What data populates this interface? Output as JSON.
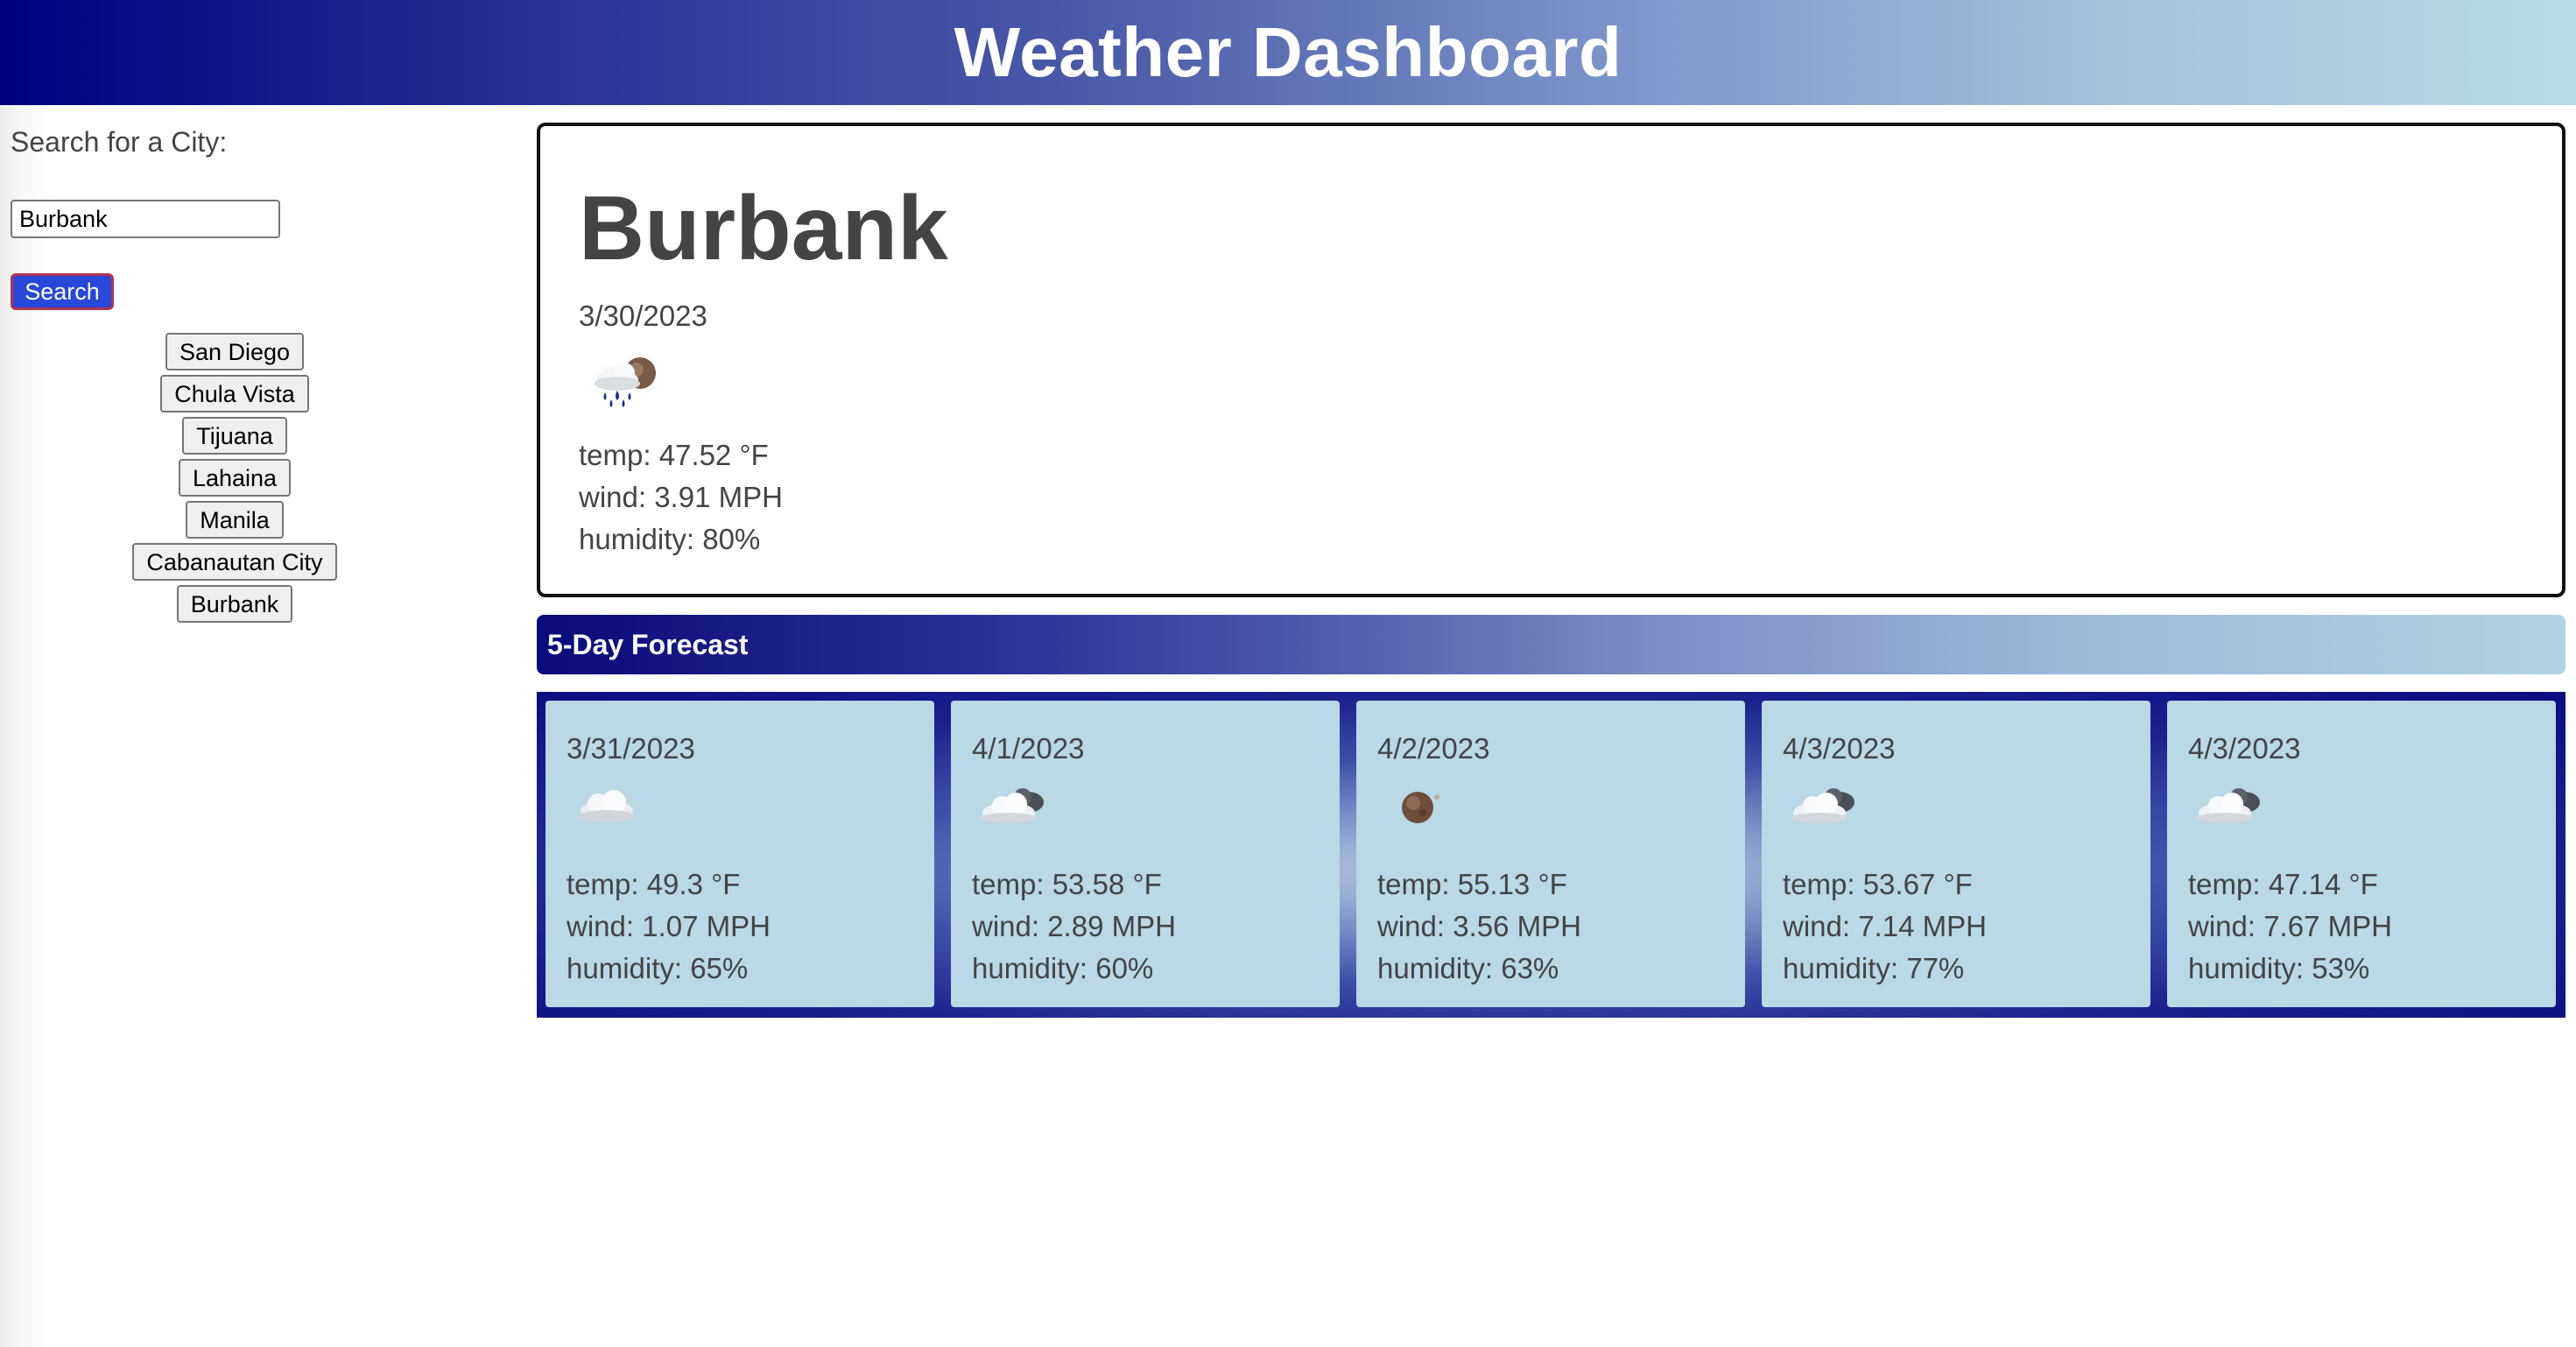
{
  "header": {
    "title": "Weather Dashboard"
  },
  "sidebar": {
    "search_label": "Search for a City:",
    "search_value": "Burbank",
    "search_button": "Search",
    "cities": [
      "San Diego",
      "Chula Vista",
      "Tijuana",
      "Lahaina",
      "Manila",
      "Cabanautan City",
      "Burbank"
    ]
  },
  "current": {
    "city": "Burbank",
    "date": "3/30/2023",
    "icon": "rain-cloud-icon",
    "temp": "temp: 47.52 °F",
    "wind": "wind: 3.91 MPH",
    "humidity": "humidity: 80%"
  },
  "forecast": {
    "title": "5-Day Forecast",
    "days": [
      {
        "date": "3/31/2023",
        "icon": "cloud-icon",
        "temp": "temp: 49.3 °F",
        "wind": "wind: 1.07 MPH",
        "humidity": "humidity: 65%"
      },
      {
        "date": "4/1/2023",
        "icon": "partly-cloudy-icon",
        "temp": "temp: 53.58 °F",
        "wind": "wind: 2.89 MPH",
        "humidity": "humidity: 60%"
      },
      {
        "date": "4/2/2023",
        "icon": "moon-icon",
        "temp": "temp: 55.13 °F",
        "wind": "wind: 3.56 MPH",
        "humidity": "humidity: 63%"
      },
      {
        "date": "4/3/2023",
        "icon": "partly-cloudy-icon",
        "temp": "temp: 53.67 °F",
        "wind": "wind: 7.14 MPH",
        "humidity": "humidity: 77%"
      },
      {
        "date": "4/3/2023",
        "icon": "partly-cloudy-icon",
        "temp": "temp: 47.14 °F",
        "wind": "wind: 7.67 MPH",
        "humidity": "humidity: 53%"
      }
    ]
  },
  "colors": {
    "header_start": "#000080",
    "header_end": "#b7dbe6",
    "search_button": "#2947d9",
    "card_bg": "#b8d9e5",
    "text": "#444444"
  }
}
